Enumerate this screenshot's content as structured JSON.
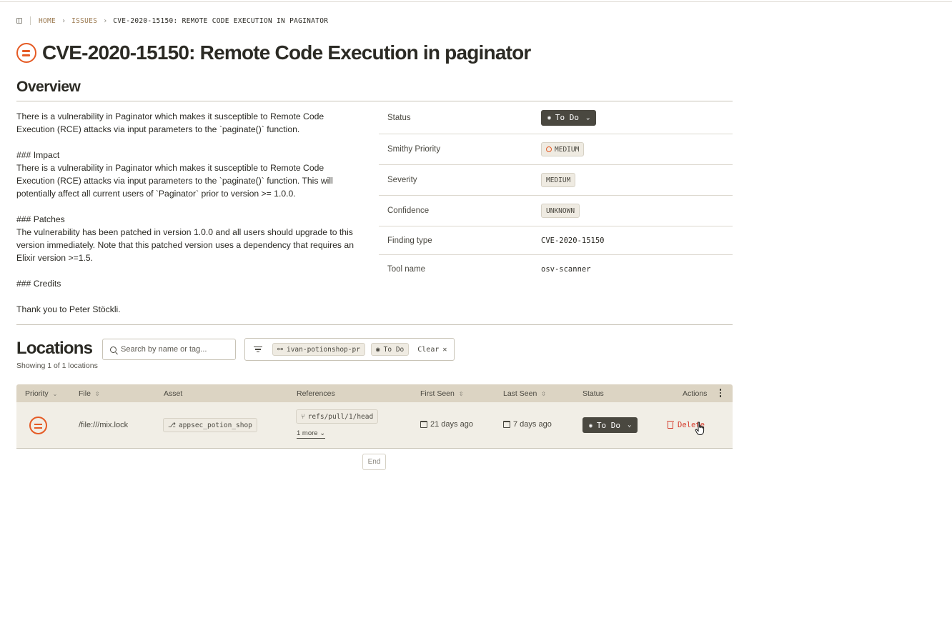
{
  "breadcrumb": {
    "home": "HOME",
    "issues": "ISSUES",
    "current": "CVE-2020-15150: REMOTE CODE EXECUTION IN PAGINATOR"
  },
  "page": {
    "title": "CVE-2020-15150: Remote Code Execution in paginator"
  },
  "overview": {
    "heading": "Overview",
    "description": "There is a vulnerability in Paginator which makes it susceptible to Remote Code\nExecution (RCE) attacks via input parameters to the `paginate()` function.\n\n### Impact\nThere is a vulnerability in Paginator which makes it susceptible to Remote Code\nExecution (RCE) attacks via input parameters to the `paginate()` function. This will\npotentially affect all current users of `Paginator` prior to version >= 1.0.0.\n\n### Patches\nThe vulnerability has been patched in version 1.0.0 and all users should upgrade to this\nversion immediately. Note that this patched version uses a dependency that requires an\nElixir version >=1.5.\n\n### Credits\n\nThank you to Peter Stöckli."
  },
  "details": {
    "status_label": "Status",
    "status_value": "To Do",
    "priority_label": "Smithy Priority",
    "priority_value": "MEDIUM",
    "severity_label": "Severity",
    "severity_value": "MEDIUM",
    "confidence_label": "Confidence",
    "confidence_value": "UNKNOWN",
    "finding_type_label": "Finding type",
    "finding_type_value": "CVE-2020-15150",
    "tool_label": "Tool name",
    "tool_value": "osv-scanner"
  },
  "locations": {
    "heading": "Locations",
    "subtitle": "Showing 1 of 1 locations",
    "search_placeholder": "Search by name or tag...",
    "filters": [
      "ivan-potionshop-pr",
      "To Do"
    ],
    "clear_label": "Clear",
    "columns": {
      "priority": "Priority",
      "file": "File",
      "asset": "Asset",
      "references": "References",
      "first_seen": "First Seen",
      "last_seen": "Last Seen",
      "status": "Status",
      "actions": "Actions"
    },
    "rows": [
      {
        "priority": "medium",
        "file": "/file:///mix.lock",
        "asset": "appsec_potion_shop",
        "reference": "refs/pull/1/head",
        "more": "1 more",
        "first_seen": "21 days ago",
        "last_seen": "7 days ago",
        "status": "To Do",
        "action": "Delete"
      }
    ],
    "end_label": "End"
  },
  "colors": {
    "accent_orange": "#e55b25",
    "dark_button": "#4a4840",
    "table_header": "#dcd4c3",
    "row_bg": "#f1eee6",
    "danger": "#d43a2b"
  }
}
